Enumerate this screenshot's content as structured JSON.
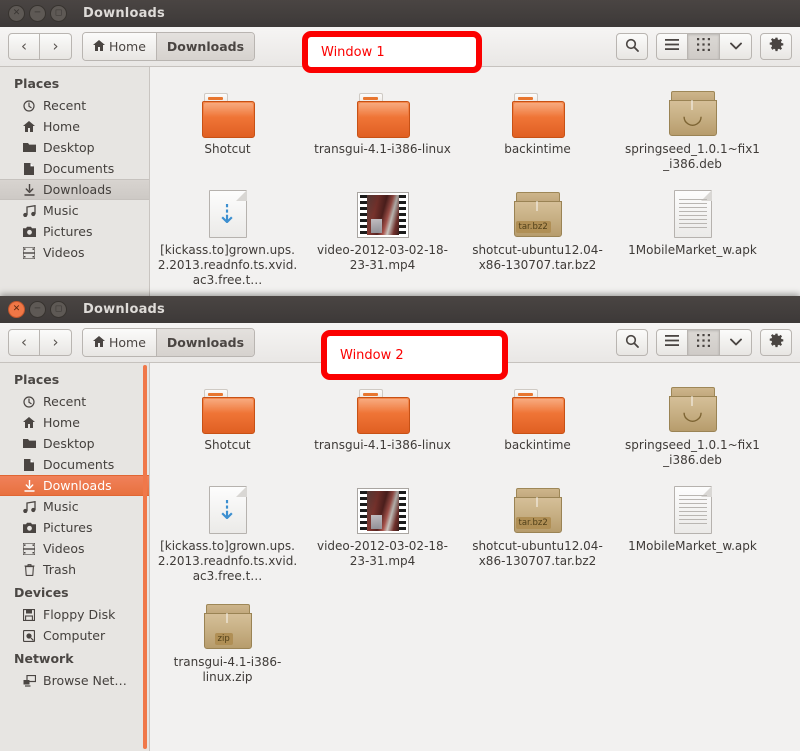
{
  "windows": [
    {
      "id": "window-1",
      "title": "Downloads",
      "active": false,
      "window_buttons": {
        "close": "close-icon",
        "minimize": "minimize-icon",
        "maximize": "maximize-icon"
      },
      "toolbar": {
        "back_label": "‹",
        "forward_label": "›",
        "breadcrumb": [
          {
            "label": "Home",
            "icon": "home-icon",
            "current": false
          },
          {
            "label": "Downloads",
            "icon": "",
            "current": true
          }
        ],
        "search_icon": "search-icon",
        "list_view_icon": "list-view-icon",
        "grid_view_icon": "grid-view-icon",
        "view_dropdown_icon": "chevron-down-icon",
        "settings_icon": "gear-icon",
        "active_view": "grid"
      },
      "sidebar": {
        "sections": [
          {
            "heading": "Places",
            "items": [
              {
                "label": "Recent",
                "icon": "clock-icon",
                "selected": false
              },
              {
                "label": "Home",
                "icon": "home-icon",
                "selected": false
              },
              {
                "label": "Desktop",
                "icon": "folder-icon",
                "selected": false
              },
              {
                "label": "Documents",
                "icon": "document-icon",
                "selected": false
              },
              {
                "label": "Downloads",
                "icon": "download-icon",
                "selected": true
              },
              {
                "label": "Music",
                "icon": "music-icon",
                "selected": false
              },
              {
                "label": "Pictures",
                "icon": "camera-icon",
                "selected": false
              },
              {
                "label": "Videos",
                "icon": "film-icon",
                "selected": false
              }
            ]
          }
        ],
        "selection_style": "grey"
      },
      "files": [
        {
          "name": "Shotcut",
          "type": "folder"
        },
        {
          "name": "transgui-4.1-i386-linux",
          "type": "folder"
        },
        {
          "name": "backintime",
          "type": "folder"
        },
        {
          "name": "springseed_1.0.1~fix1_i386.deb",
          "type": "deb"
        },
        {
          "name": "[kickass.to]grown.ups.2.2013.readnfo.ts.xvid.ac3.free.t…",
          "type": "download-doc"
        },
        {
          "name": "video-2012-03-02-18-23-31.mp4",
          "type": "video"
        },
        {
          "name": "shotcut-ubuntu12.04-x86-130707.tar.bz2",
          "type": "archive",
          "badge": "tar.bz2"
        },
        {
          "name": "1MobileMarket_w.apk",
          "type": "text-doc"
        }
      ]
    },
    {
      "id": "window-2",
      "title": "Downloads",
      "active": true,
      "window_buttons": {
        "close": "close-icon",
        "minimize": "minimize-icon",
        "maximize": "maximize-icon"
      },
      "toolbar": {
        "back_label": "‹",
        "forward_label": "›",
        "breadcrumb": [
          {
            "label": "Home",
            "icon": "home-icon",
            "current": false
          },
          {
            "label": "Downloads",
            "icon": "",
            "current": true
          }
        ],
        "search_icon": "search-icon",
        "list_view_icon": "list-view-icon",
        "grid_view_icon": "grid-view-icon",
        "view_dropdown_icon": "chevron-down-icon",
        "settings_icon": "gear-icon",
        "active_view": "grid"
      },
      "sidebar": {
        "sections": [
          {
            "heading": "Places",
            "items": [
              {
                "label": "Recent",
                "icon": "clock-icon",
                "selected": false
              },
              {
                "label": "Home",
                "icon": "home-icon",
                "selected": false
              },
              {
                "label": "Desktop",
                "icon": "folder-icon",
                "selected": false
              },
              {
                "label": "Documents",
                "icon": "document-icon",
                "selected": false
              },
              {
                "label": "Downloads",
                "icon": "download-icon",
                "selected": true
              },
              {
                "label": "Music",
                "icon": "music-icon",
                "selected": false
              },
              {
                "label": "Pictures",
                "icon": "camera-icon",
                "selected": false
              },
              {
                "label": "Videos",
                "icon": "film-icon",
                "selected": false
              },
              {
                "label": "Trash",
                "icon": "trash-icon",
                "selected": false
              }
            ]
          },
          {
            "heading": "Devices",
            "items": [
              {
                "label": "Floppy Disk",
                "icon": "floppy-icon",
                "selected": false
              },
              {
                "label": "Computer",
                "icon": "computer-icon",
                "selected": false
              }
            ]
          },
          {
            "heading": "Network",
            "items": [
              {
                "label": "Browse Net…",
                "icon": "network-icon",
                "selected": false
              }
            ]
          }
        ],
        "selection_style": "orange",
        "scrollbar_color": "#f0784a"
      },
      "files": [
        {
          "name": "Shotcut",
          "type": "folder"
        },
        {
          "name": "transgui-4.1-i386-linux",
          "type": "folder"
        },
        {
          "name": "backintime",
          "type": "folder"
        },
        {
          "name": "springseed_1.0.1~fix1_i386.deb",
          "type": "deb"
        },
        {
          "name": "[kickass.to]grown.ups.2.2013.readnfo.ts.xvid.ac3.free.t…",
          "type": "download-doc"
        },
        {
          "name": "video-2012-03-02-18-23-31.mp4",
          "type": "video"
        },
        {
          "name": "shotcut-ubuntu12.04-x86-130707.tar.bz2",
          "type": "archive",
          "badge": "tar.bz2"
        },
        {
          "name": "1MobileMarket_w.apk",
          "type": "text-doc"
        },
        {
          "name": "transgui-4.1-i386-linux.zip",
          "type": "archive",
          "badge": "zip"
        }
      ]
    }
  ],
  "annotations": [
    {
      "id": "annot-1",
      "text": "Window 1",
      "color": "#fb0000"
    },
    {
      "id": "annot-2",
      "text": "Window 2",
      "color": "#fb0000"
    }
  ]
}
